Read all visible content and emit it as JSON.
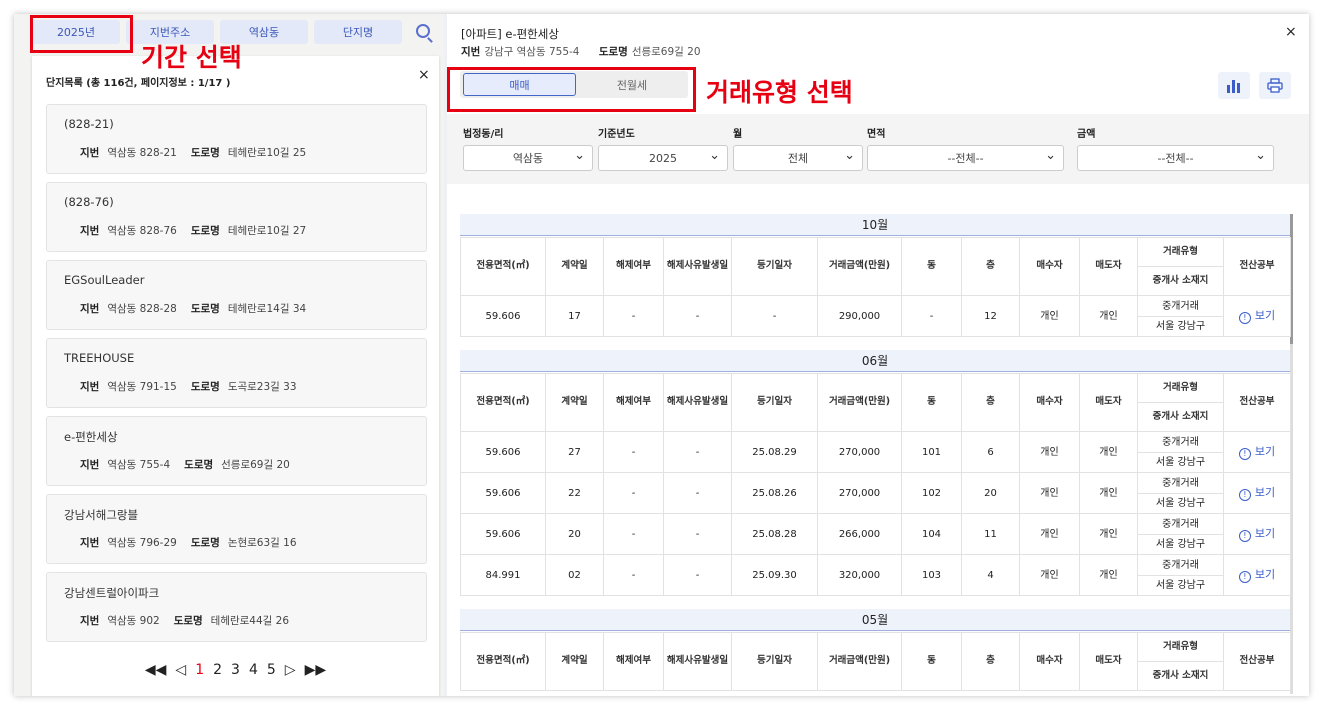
{
  "topbar": {
    "buttons": [
      "2025년",
      "지번주소",
      "역삼동",
      "단지명"
    ]
  },
  "annotations": {
    "period_label": "기간 선택",
    "trade_type_label": "거래유형 선택"
  },
  "list": {
    "header": "단지목록 (총 116건, 페이지정보 : 1/17 )",
    "close": "×",
    "jibun_label": "지번",
    "road_label": "도로명",
    "items": [
      {
        "name": "(828-21)",
        "jibun": "역삼동 828-21",
        "road": "테헤란로10길 25"
      },
      {
        "name": "(828-76)",
        "jibun": "역삼동 828-76",
        "road": "테헤란로10길 27"
      },
      {
        "name": "EGSoulLeader",
        "jibun": "역삼동 828-28",
        "road": "테헤란로14길 34"
      },
      {
        "name": "TREEHOUSE",
        "jibun": "역삼동 791-15",
        "road": "도곡로23길 33"
      },
      {
        "name": "e-편한세상",
        "jibun": "역삼동 755-4",
        "road": "선릉로69길 20"
      },
      {
        "name": "강남서해그랑블",
        "jibun": "역삼동 796-29",
        "road": "논현로63길 16"
      },
      {
        "name": "강남센트럴아이파크",
        "jibun": "역삼동 902",
        "road": "테헤란로44길 26"
      }
    ],
    "pagination": {
      "first": "◀◀",
      "prev": "◁",
      "pages": [
        "1",
        "2",
        "3",
        "4",
        "5"
      ],
      "next": "▷",
      "last": "▶▶",
      "current": "1"
    }
  },
  "detail": {
    "title": "[아파트] e-편한세상",
    "jibun_label": "지번",
    "jibun": "강남구 역삼동 755-4",
    "road_label": "도로명",
    "road": "선릉로69길 20",
    "close": "×",
    "tabs": [
      "매매",
      "전월세"
    ],
    "icons": [
      "bar-chart-icon",
      "print-icon"
    ],
    "filters": [
      {
        "label": "법정동/리",
        "value": "역삼동"
      },
      {
        "label": "기준년도",
        "value": "2025"
      },
      {
        "label": "월",
        "value": "전체"
      },
      {
        "label": "면적",
        "value": "--전체--"
      },
      {
        "label": "금액",
        "value": "--전체--"
      }
    ]
  },
  "table": {
    "headers": {
      "area": "전용면적(㎡)",
      "contract_day": "계약일",
      "cancel": "해제여부",
      "cancel_date": "해제사유발생일",
      "reg_date": "등기일자",
      "price": "거래금액(만원)",
      "dong": "동",
      "floor": "층",
      "buyer": "매수자",
      "seller": "매도자",
      "trade_type": "거래유형",
      "agent_loc": "중개사 소재지",
      "doc": "전산공부"
    },
    "view_label": "보기",
    "months": [
      {
        "month": "10월",
        "rows": [
          {
            "area": "59.606",
            "day": "17",
            "cancel": "-",
            "cancel_date": "-",
            "reg": "-",
            "price": "290,000",
            "dong": "-",
            "floor": "12",
            "buyer": "개인",
            "seller": "개인",
            "type": "중개거래",
            "loc": "서울 강남구"
          }
        ]
      },
      {
        "month": "06월",
        "rows": [
          {
            "area": "59.606",
            "day": "27",
            "cancel": "-",
            "cancel_date": "-",
            "reg": "25.08.29",
            "price": "270,000",
            "dong": "101",
            "floor": "6",
            "buyer": "개인",
            "seller": "개인",
            "type": "중개거래",
            "loc": "서울 강남구"
          },
          {
            "area": "59.606",
            "day": "22",
            "cancel": "-",
            "cancel_date": "-",
            "reg": "25.08.26",
            "price": "270,000",
            "dong": "102",
            "floor": "20",
            "buyer": "개인",
            "seller": "개인",
            "type": "중개거래",
            "loc": "서울 강남구"
          },
          {
            "area": "59.606",
            "day": "20",
            "cancel": "-",
            "cancel_date": "-",
            "reg": "25.08.28",
            "price": "266,000",
            "dong": "104",
            "floor": "11",
            "buyer": "개인",
            "seller": "개인",
            "type": "중개거래",
            "loc": "서울 강남구"
          },
          {
            "area": "84.991",
            "day": "02",
            "cancel": "-",
            "cancel_date": "-",
            "reg": "25.09.30",
            "price": "320,000",
            "dong": "103",
            "floor": "4",
            "buyer": "개인",
            "seller": "개인",
            "type": "중개거래",
            "loc": "서울 강남구"
          }
        ]
      },
      {
        "month": "05월",
        "rows": []
      }
    ]
  }
}
